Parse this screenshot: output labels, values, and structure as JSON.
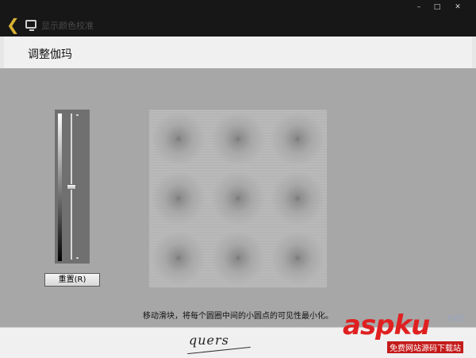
{
  "window": {
    "title": "显示颜色校准",
    "controls": {
      "minimize": "–",
      "maximize": "□",
      "close": "✕"
    }
  },
  "header": {
    "title": "调整伽玛"
  },
  "slider": {
    "level": 0.5
  },
  "reset_button": {
    "label": "重置(R)"
  },
  "gamma_pattern": {
    "rows": 3,
    "cols": 3
  },
  "instruction": "移动滑块，将每个圆圈中间的小圆点的可见性最小化。",
  "footer": {
    "signature": "quers"
  },
  "watermark": {
    "logo": "aspku",
    "domain": ".net",
    "tagline": "免费网站源码下载站"
  },
  "colors": {
    "titlebar": "#171717",
    "accent": "#d9b233",
    "background": "#a7a7a7",
    "watermark": "#e02020"
  },
  "icons": {
    "back": "back-arrow-icon",
    "display": "monitor-icon"
  }
}
